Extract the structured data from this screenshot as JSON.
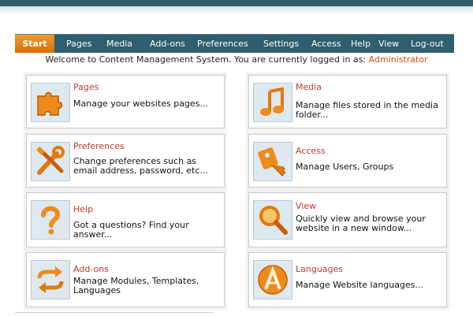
{
  "nav": {
    "items": [
      "Start",
      "Pages",
      "Media",
      "Add-ons",
      "Preferences",
      "Settings",
      "Access",
      "Help",
      "View",
      "Log-out"
    ]
  },
  "welcome": {
    "text": "Welcome to Content Management System. You are currently logged in as: ",
    "user": "Administrator"
  },
  "cards": [
    {
      "title": "Pages",
      "desc": "Manage your websites pages...",
      "icon": "puzzle-icon"
    },
    {
      "title": "Media",
      "desc": "Manage files stored in the media folder...",
      "icon": "music-note-icon"
    },
    {
      "title": "Preferences",
      "desc": "Change preferences such as email address, password, etc...",
      "icon": "tools-icon"
    },
    {
      "title": "Access",
      "desc": "Manage Users, Groups",
      "icon": "key-icon"
    },
    {
      "title": "Help",
      "desc": "Got a questions? Find your answer...",
      "icon": "question-icon"
    },
    {
      "title": "View",
      "desc": "Quickly view and browse your website in a new window...",
      "icon": "magnifier-icon"
    },
    {
      "title": "Add-ons",
      "desc": "Manage Modules, Templates, Languages",
      "icon": "arrows-icon"
    },
    {
      "title": "Languages",
      "desc": "Manage Website  languages...",
      "icon": "letter-a-icon"
    }
  ],
  "colors": {
    "accent": "#f08a1c",
    "nav_bg": "#2e5e70",
    "title": "#c0392b"
  }
}
